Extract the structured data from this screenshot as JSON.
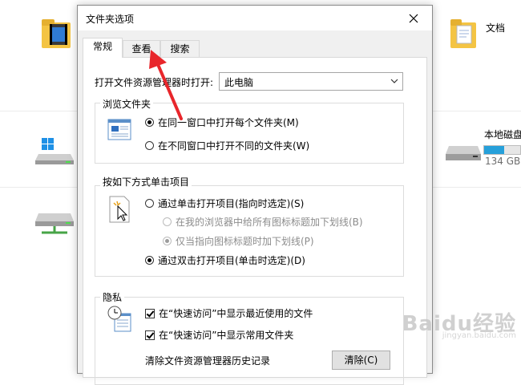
{
  "background": {
    "documents_label": "文档",
    "drive_label": "本地磁盘",
    "drive_size": "134 GB",
    "drive_used_fraction": 0.55
  },
  "dialog": {
    "title": "文件夹选项",
    "tabs": [
      {
        "label": "常规",
        "active": true
      },
      {
        "label": "查看",
        "active": false
      },
      {
        "label": "搜索",
        "active": false
      }
    ],
    "open_explorer_label": "打开文件资源管理器时打开:",
    "open_explorer_value": "此电脑",
    "browse_group": {
      "title": "浏览文件夹",
      "options": [
        {
          "label": "在同一窗口中打开每个文件夹(M)",
          "checked": true
        },
        {
          "label": "在不同窗口中打开不同的文件夹(W)",
          "checked": false
        }
      ]
    },
    "click_group": {
      "title": "按如下方式单击项目",
      "single_click": "通过单击打开项目(指向时选定)(S)",
      "underline_browser": "在我的浏览器中给所有图标标题加下划线(B)",
      "underline_point": "仅当指向图标标题时加下划线(P)",
      "double_click": "通过双击打开项目(单击时选定)(D)"
    },
    "privacy_group": {
      "title": "隐私",
      "recent_files": "在“快速访问”中显示最近使用的文件",
      "frequent_folders": "在“快速访问”中显示常用文件夹",
      "clear_label": "清除文件资源管理器历史记录",
      "clear_button": "清除(C)"
    }
  },
  "annotation": {
    "color": "#e8262b"
  },
  "watermark": {
    "text": "Baidu经验",
    "sub": "jingyan.baidu.com"
  }
}
